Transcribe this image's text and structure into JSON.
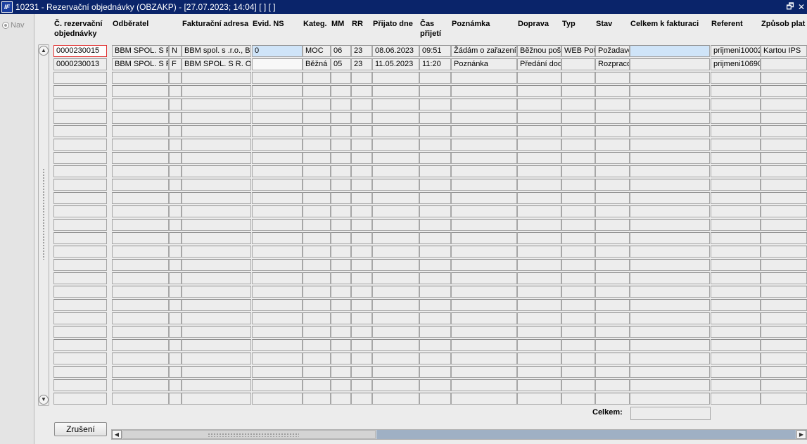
{
  "window": {
    "title": "10231 - Rezervační objednávky (OBZAKP) - [27.07.2023; 14:04] [ ] [ ]",
    "icon_text": "IF",
    "restore_glyph": "🗗",
    "close_glyph": "✕"
  },
  "nav": {
    "label": "Nav"
  },
  "columns": [
    {
      "key": "cislo",
      "label": "Č. rezervační objednávky"
    },
    {
      "key": "odberatel",
      "label": "Odběratel"
    },
    {
      "key": "flag",
      "label": ""
    },
    {
      "key": "fakt_adresa",
      "label": "Fakturační adresa"
    },
    {
      "key": "evid_ns",
      "label": "Evid. NS"
    },
    {
      "key": "kateg",
      "label": "Kateg."
    },
    {
      "key": "mm",
      "label": "MM"
    },
    {
      "key": "rr",
      "label": "RR"
    },
    {
      "key": "prijato",
      "label": "Přijato dne"
    },
    {
      "key": "cas",
      "label": "Čas přijetí"
    },
    {
      "key": "poznamka",
      "label": "Poznámka"
    },
    {
      "key": "doprava",
      "label": "Doprava"
    },
    {
      "key": "typ",
      "label": "Typ"
    },
    {
      "key": "stav",
      "label": "Stav"
    },
    {
      "key": "celkem",
      "label": "Celkem k fakturaci"
    },
    {
      "key": "referent",
      "label": "Referent"
    },
    {
      "key": "zpusob",
      "label": "Způsob plat"
    }
  ],
  "rows": [
    {
      "cislo": "0000230015",
      "odberatel": "BBM SPOL. S R",
      "flag": "N",
      "fakt_adresa": "BBM spol. s .r.o., Bl",
      "evid_ns": "0",
      "kateg": "MOC",
      "mm": "06",
      "rr": "23",
      "prijato": "08.06.2023",
      "cas": "09:51",
      "poznamka": "Žádám o zařazení",
      "doprava": "Běžnou poš",
      "typ": "WEB Pot",
      "stav": "Požadave",
      "celkem": "",
      "referent": "prijmeni10002",
      "zpusob": "Kartou IPS"
    },
    {
      "cislo": "0000230013",
      "odberatel": "BBM SPOL. S R",
      "flag": "F",
      "fakt_adresa": "BBM SPOL. S R. O.",
      "evid_ns": "",
      "kateg": "Běžná",
      "mm": "05",
      "rr": "23",
      "prijato": "11.05.2023",
      "cas": "11:20",
      "poznamka": "Poznánka",
      "doprava": "Předání dod",
      "typ": "",
      "stav": "Rozpraco",
      "celkem": "",
      "referent": "prijmeni10690",
      "zpusob": ""
    }
  ],
  "empty_row_count": 25,
  "footer": {
    "celkem_label": "Celkem:",
    "celkem_value": "",
    "cancel_label": "Zrušení"
  },
  "colors": {
    "titlebar": "#0a246a",
    "highlight_cell": "#cfe4f8",
    "focus_border": "#e03030"
  }
}
